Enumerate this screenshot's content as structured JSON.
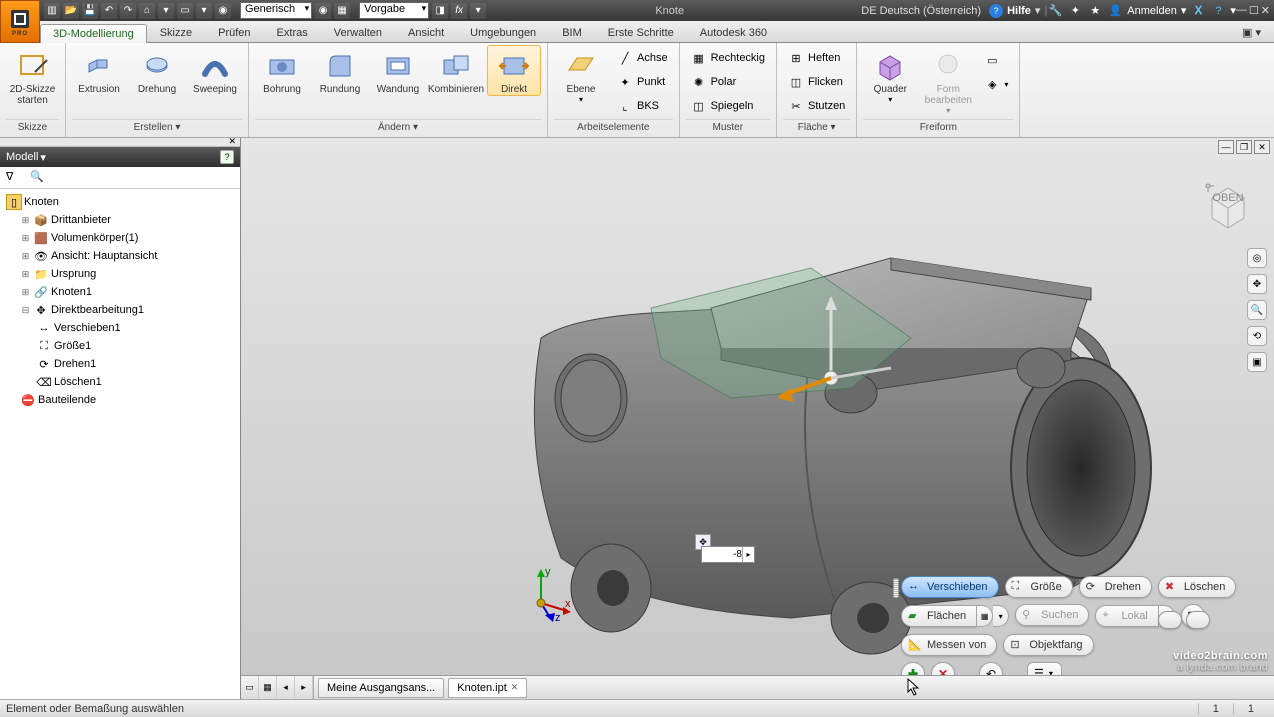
{
  "title_bar": {
    "material_style": "Generisch",
    "appearance": "Vorgabe",
    "doc_short": "Knote",
    "locale": "DE Deutsch (Österreich)",
    "help": "Hilfe",
    "signin": "Anmelden"
  },
  "tabs": [
    "3D-Modellierung",
    "Skizze",
    "Prüfen",
    "Extras",
    "Verwalten",
    "Ansicht",
    "Umgebungen",
    "BIM",
    "Erste Schritte",
    "Autodesk 360"
  ],
  "ribbon": {
    "sketch": {
      "start": "2D-Skizze\nstarten",
      "caption": "Skizze"
    },
    "create": {
      "items": [
        "Extrusion",
        "Drehung",
        "Sweeping"
      ],
      "caption": "Erstellen ▾"
    },
    "modify": {
      "items": [
        "Bohrung",
        "Rundung",
        "Wandung",
        "Kombinieren",
        "Direkt"
      ],
      "caption": "Ändern ▾"
    },
    "workfeat": {
      "big": "Ebene",
      "small": [
        "Achse",
        "Punkt",
        "BKS"
      ],
      "caption": "Arbeitselemente"
    },
    "pattern": {
      "small": [
        "Rechteckig",
        "Polar",
        "Spiegeln"
      ],
      "caption": "Muster"
    },
    "surface": {
      "small": [
        "Heften",
        "Flicken",
        "Stutzen"
      ],
      "caption": "Fläche ▾"
    },
    "freeform": {
      "big1": "Quader",
      "big2": "Form\nbearbeiten",
      "caption": "Freiform"
    }
  },
  "browser": {
    "title": "Modell",
    "root": "Knoten",
    "nodes": [
      "Drittanbieter",
      "Volumenkörper(1)",
      "Ansicht: Hauptansicht",
      "Ursprung",
      "Knoten1",
      "Direktbearbeitung1"
    ],
    "subnodes": [
      "Verschieben1",
      "Größe1",
      "Drehen1",
      "Löschen1"
    ],
    "end": "Bauteilende"
  },
  "input_value": "-8",
  "minitool": {
    "move": "Verschieben",
    "size": "Größe",
    "rotate": "Drehen",
    "delete": "Löschen",
    "faces": "Flächen",
    "search": "Suchen",
    "local": "Lokal",
    "measure": "Messen von",
    "osnap": "Objektfang"
  },
  "doc_tabs": [
    "Meine Ausgangsans...",
    "Knoten.ipt"
  ],
  "status": {
    "prompt": "Element oder Bemaßung auswählen",
    "n1": "1",
    "n2": "1"
  },
  "watermark": {
    "l1": "video2brain.com",
    "l2": "a lynda.com brand"
  },
  "triad_labels": {
    "x": "x",
    "y": "y",
    "z": "z"
  }
}
